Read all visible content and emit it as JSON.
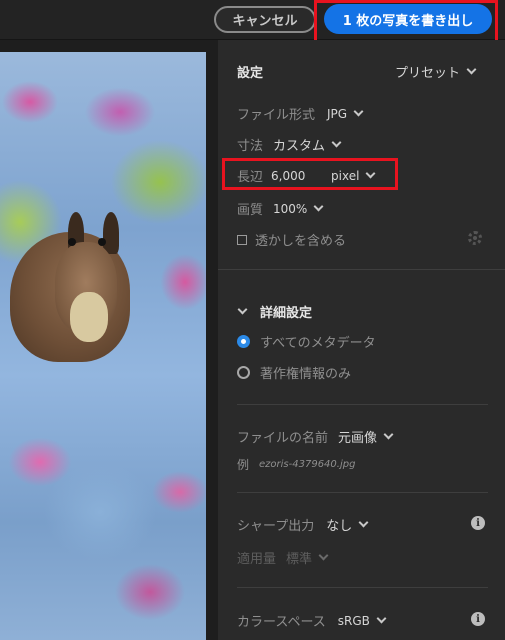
{
  "topbar": {
    "cancel_label": "キャンセル",
    "export_label": "1 枚の写真を書き出し",
    "export_color": "#1473e6"
  },
  "settings": {
    "title": "設定",
    "preset_label": "プリセット",
    "file_format_label": "ファイル形式",
    "file_format_value": "JPG",
    "size_label": "寸法",
    "size_value": "カスタム",
    "long_edge_label": "長辺",
    "long_edge_value": "6,000",
    "long_edge_unit": "pixel",
    "quality_label": "画質",
    "quality_value": "100%",
    "watermark_label": "透かしを含める",
    "watermark_checked": false
  },
  "advanced": {
    "title": "詳細設定",
    "metadata_options": [
      "すべてのメタデータ",
      "著作権情報のみ"
    ],
    "metadata_selected": 0,
    "file_name_label": "ファイルの名前",
    "file_name_value": "元画像",
    "example_label": "例",
    "example_value": "ezoris-4379640.jpg",
    "sharpen_label": "シャープ出力",
    "sharpen_value": "なし",
    "amount_label": "適用量",
    "amount_value": "標準",
    "color_space_label": "カラースペース",
    "color_space_value": "sRGB"
  },
  "icons": {
    "info": "info-icon",
    "gear": "gear-icon",
    "chevron": "chevron-down-icon"
  },
  "highlight_color": "#e8131f"
}
